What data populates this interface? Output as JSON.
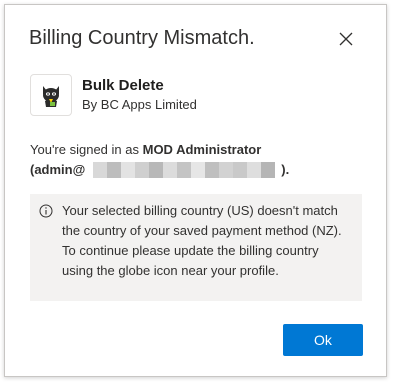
{
  "dialog": {
    "title": "Billing Country Mismatch.",
    "close_icon": "close-icon"
  },
  "app": {
    "name": "Bulk Delete",
    "publisher": "By BC Apps Limited",
    "icon": "cat-mascot-icon"
  },
  "signed_in": {
    "prefix": "You're signed in as",
    "user": "MOD Administrator",
    "email_open": "(admin@",
    "email_close": ")."
  },
  "notice": {
    "icon": "info-icon",
    "text": "Your selected billing country (US) doesn't match the country of your saved payment method (NZ). To continue please update the billing country using the globe icon near your profile."
  },
  "actions": {
    "ok_label": "Ok"
  },
  "colors": {
    "accent": "#0078d4",
    "notice_bg": "#f3f2f1"
  }
}
